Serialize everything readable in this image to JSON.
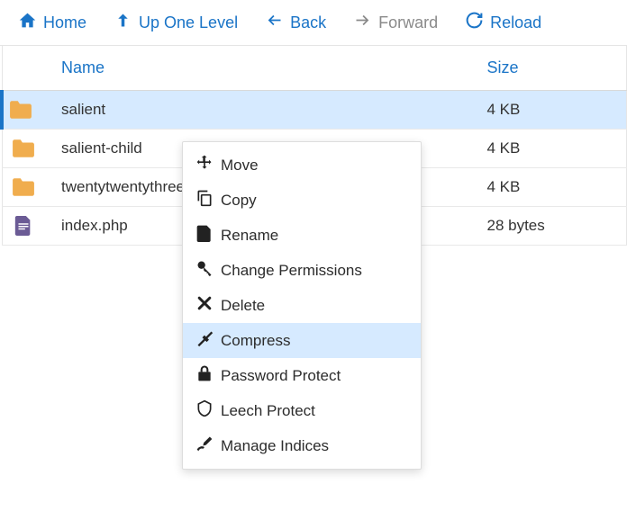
{
  "toolbar": {
    "home": "Home",
    "up": "Up One Level",
    "back": "Back",
    "forward": "Forward",
    "reload": "Reload"
  },
  "columns": {
    "name": "Name",
    "size": "Size"
  },
  "files": [
    {
      "name": "salient",
      "size": "4 KB",
      "type": "folder",
      "selected": true
    },
    {
      "name": "salient-child",
      "size": "4 KB",
      "type": "folder",
      "selected": false
    },
    {
      "name": "twentytwentythree",
      "size": "4 KB",
      "type": "folder",
      "selected": false
    },
    {
      "name": "index.php",
      "size": "28 bytes",
      "type": "file",
      "selected": false
    }
  ],
  "context_menu": [
    {
      "icon": "move",
      "label": "Move"
    },
    {
      "icon": "copy",
      "label": "Copy"
    },
    {
      "icon": "rename",
      "label": "Rename"
    },
    {
      "icon": "permissions",
      "label": "Change Permissions"
    },
    {
      "icon": "delete",
      "label": "Delete"
    },
    {
      "icon": "compress",
      "label": "Compress",
      "highlight": true
    },
    {
      "icon": "password",
      "label": "Password Protect"
    },
    {
      "icon": "leech",
      "label": "Leech Protect"
    },
    {
      "icon": "indices",
      "label": "Manage Indices"
    }
  ]
}
